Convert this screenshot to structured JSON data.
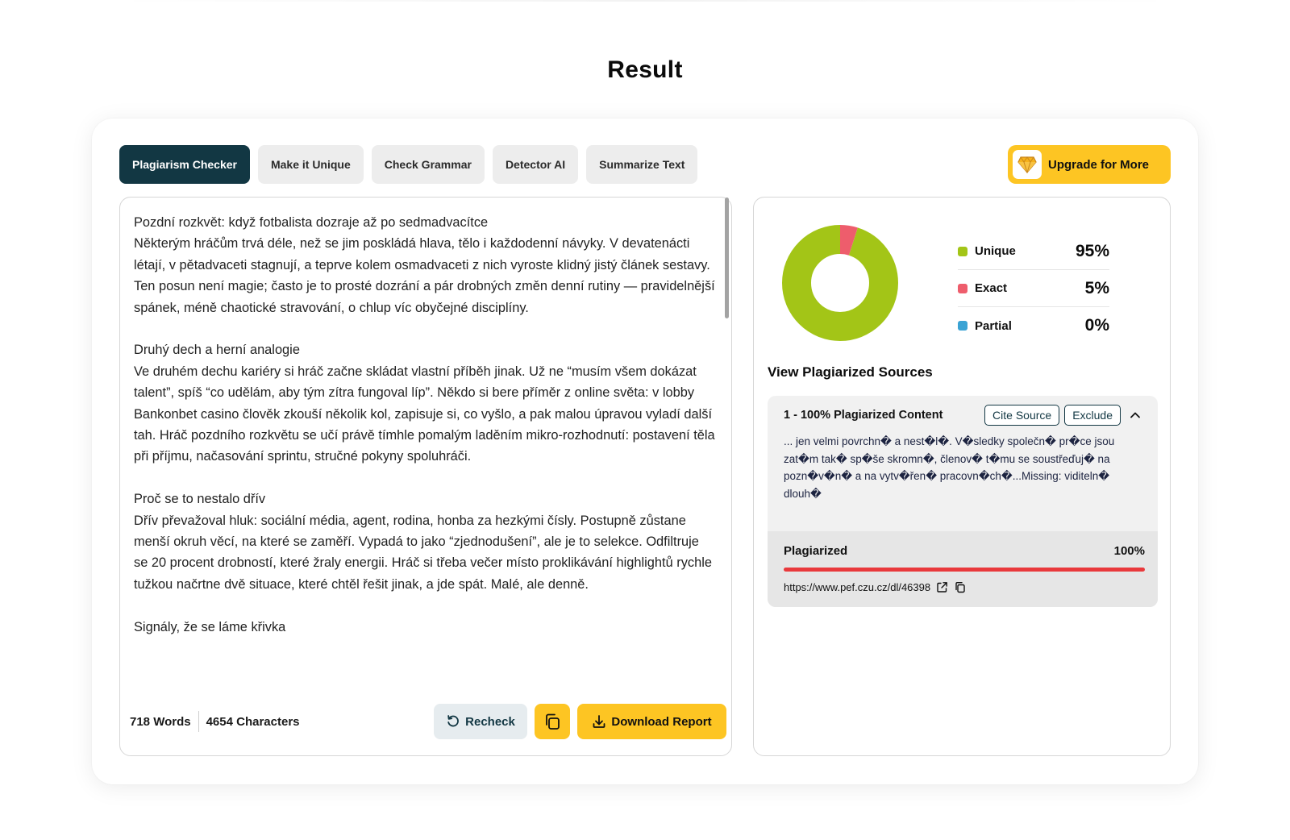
{
  "page": {
    "title": "Result"
  },
  "tabs": [
    {
      "label": "Plagiarism Checker",
      "active": true
    },
    {
      "label": "Make it Unique",
      "active": false
    },
    {
      "label": "Check Grammar",
      "active": false
    },
    {
      "label": "Detector AI",
      "active": false
    },
    {
      "label": "Summarize Text",
      "active": false
    }
  ],
  "upgrade": {
    "label": "Upgrade for More",
    "icon": "diamond-icon"
  },
  "editor": {
    "paragraphs": [
      "Pozdní rozkvět: když fotbalista dozraje až po sedmadvacítce",
      "Některým hráčům trvá déle, než se jim poskládá hlava, tělo i každodenní návyky. V devatenácti létají, v pětadvaceti stagnují, a teprve kolem osmadvaceti z nich vyroste klidný jistý článek sestavy. Ten posun není magie; často je to prosté dozrání a pár drobných změn denní rutiny — pravidelnější spánek, méně chaotické stravování, o chlup víc obyčejné disciplíny.",
      "",
      "Druhý dech a herní analogie",
      "Ve druhém dechu kariéry si hráč začne skládat vlastní příběh jinak. Už ne “musím všem dokázat talent”, spíš “co udělám, aby tým zítra fungoval líp”. Někdo si bere příměr z online světa: v lobby Bankonbet casino člověk zkouší několik kol, zapisuje si, co vyšlo, a pak malou úpravou vyladí další tah. Hráč pozdního rozkvětu se učí právě tímhle pomalým laděním mikro-rozhodnutí: postavení těla při příjmu, načasování sprintu, stručné pokyny spoluhráči.",
      "",
      "Proč se to nestalo dřív",
      "Dřív převažoval hluk: sociální média, agent, rodina, honba za hezkými čísly. Postupně zůstane menší okruh věcí, na které se zaměří. Vypadá to jako “zjednodušení”, ale je to selekce. Odfiltruje se 20 procent drobností, které žraly energii. Hráč si třeba večer místo proklikávání highlightů rychle tužkou načrtne dvě situace, které chtěl řešit jinak, a jde spát. Malé, ale denně.",
      "",
      "Signály, že se láme křivka"
    ],
    "words": "718 Words",
    "characters": "4654 Characters",
    "recheck_label": "Recheck",
    "download_label": "Download Report"
  },
  "results": {
    "legend": [
      {
        "label": "Unique",
        "value": "95%",
        "color": "#a3c517",
        "fraction": 0.95
      },
      {
        "label": "Exact",
        "value": "5%",
        "color": "#ee5d6c",
        "fraction": 0.05
      },
      {
        "label": "Partial",
        "value": "0%",
        "color": "#3aa3d4",
        "fraction": 0.0
      }
    ],
    "sources_title": "View Plagiarized Sources",
    "source": {
      "title": "1 - 100% Plagiarized Content",
      "cite_label": "Cite Source",
      "exclude_label": "Exclude",
      "snippet": "... jen velmi povrchn� a nest�l�. V�sledky společn� pr�ce jsou zat�m tak� sp�še skromn�, členov� t�mu se soustřeďuj� na pozn�v�n� a na vytv�řen� pracovn�ch�...Missing: viditeln� dlouh�",
      "plagiarized_label": "Plagiarized",
      "plagiarized_value": "100%",
      "plagiarized_fraction": 1.0,
      "url": "https://www.pef.czu.cz/dl/46398"
    }
  }
}
